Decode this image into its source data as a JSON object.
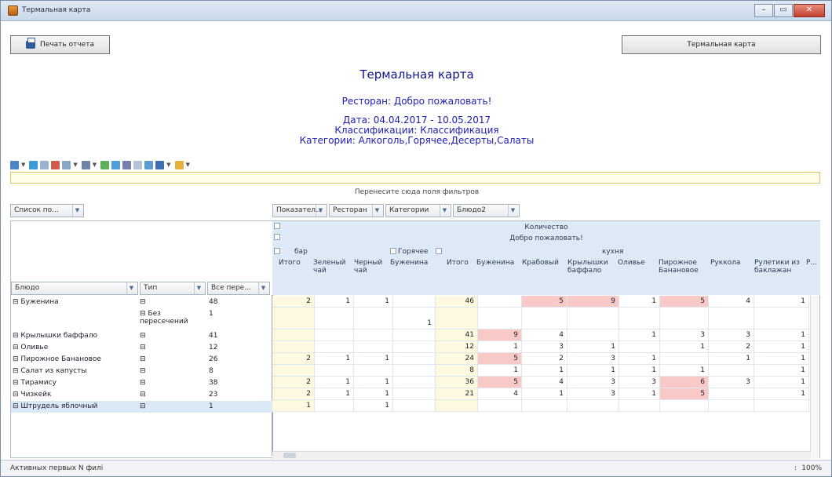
{
  "window": {
    "title": "Термальная карта",
    "controls": [
      "minimize",
      "maximize",
      "close"
    ]
  },
  "toolbar_buttons": {
    "print": "Печать отчета",
    "heatmap": "Термальная карта"
  },
  "report": {
    "title": "Термальная карта",
    "restaurant": "Ресторан: Добро пожаловать!",
    "date": "Дата: 04.04.2017 - 10.05.2017",
    "classification": "Классификации: Классификация",
    "categories": "Категории: Алкоголь,Горячее,Десерты,Салаты"
  },
  "pivot": {
    "drop_hint": "Перенесите сюда поля фильтров",
    "list_button": "Список по...",
    "column_fields": [
      "Показател...",
      "Ресторан",
      "Категории",
      "Блюдо2"
    ],
    "row_fields": [
      "Блюдо",
      "Тип",
      "Все пере..."
    ],
    "header": {
      "measure": "Количество",
      "restaurant": "Добро пожаловать!",
      "bar": "бар",
      "hot": "Горячее",
      "kitchen": "кухня",
      "columns": [
        "Итого",
        "Зеленый чай",
        "Черный чай",
        "Буженина",
        "Итого",
        "Буженина",
        "Крабовый",
        "Крылышки баффало",
        "Оливье",
        "Пирожное Банановое",
        "Руккола",
        "Рулетики из баклажан",
        "Р..."
      ]
    },
    "rows": [
      {
        "dish": "Буженина",
        "type": "",
        "total": "48",
        "cells": [
          "2",
          "1",
          "1",
          "",
          "46",
          "",
          "5",
          "9",
          "1",
          "5",
          "4",
          "1"
        ]
      },
      {
        "dish": "",
        "type": "Без пересечений",
        "total": "1",
        "cells": [
          "",
          "",
          "",
          "1",
          "",
          "",
          "",
          "",
          "",
          "",
          "",
          ""
        ]
      },
      {
        "dish": "Крылышки баффало",
        "type": "",
        "total": "41",
        "cells": [
          "",
          "",
          "",
          "",
          "41",
          "9",
          "4",
          "",
          "1",
          "3",
          "3",
          "1"
        ]
      },
      {
        "dish": "Оливье",
        "type": "",
        "total": "12",
        "cells": [
          "",
          "",
          "",
          "",
          "12",
          "1",
          "3",
          "1",
          "",
          "1",
          "2",
          "1"
        ]
      },
      {
        "dish": "Пирожное Банановое",
        "type": "",
        "total": "26",
        "cells": [
          "2",
          "1",
          "1",
          "",
          "24",
          "5",
          "2",
          "3",
          "1",
          "",
          "1",
          "1"
        ]
      },
      {
        "dish": "Салат из капусты",
        "type": "",
        "total": "8",
        "cells": [
          "",
          "",
          "",
          "",
          "8",
          "1",
          "1",
          "1",
          "1",
          "1",
          "",
          "1"
        ]
      },
      {
        "dish": "Тирамису",
        "type": "",
        "total": "38",
        "cells": [
          "2",
          "1",
          "1",
          "",
          "36",
          "5",
          "4",
          "3",
          "3",
          "6",
          "3",
          "1"
        ]
      },
      {
        "dish": "Чизкейк",
        "type": "",
        "total": "23",
        "cells": [
          "2",
          "1",
          "1",
          "",
          "21",
          "4",
          "1",
          "3",
          "1",
          "5",
          "",
          "1"
        ]
      },
      {
        "dish": "Штрудель яблочный",
        "type": "",
        "total": "1",
        "cells": [
          "1",
          "",
          "1",
          "",
          "",
          "",
          "",
          "",
          "",
          "",
          "",
          ""
        ]
      }
    ],
    "highlight_color": "#f9c9c7",
    "total_color": "#fdf9e1"
  },
  "status": {
    "left": "Активных первых N филі",
    "zoom": "100%"
  }
}
